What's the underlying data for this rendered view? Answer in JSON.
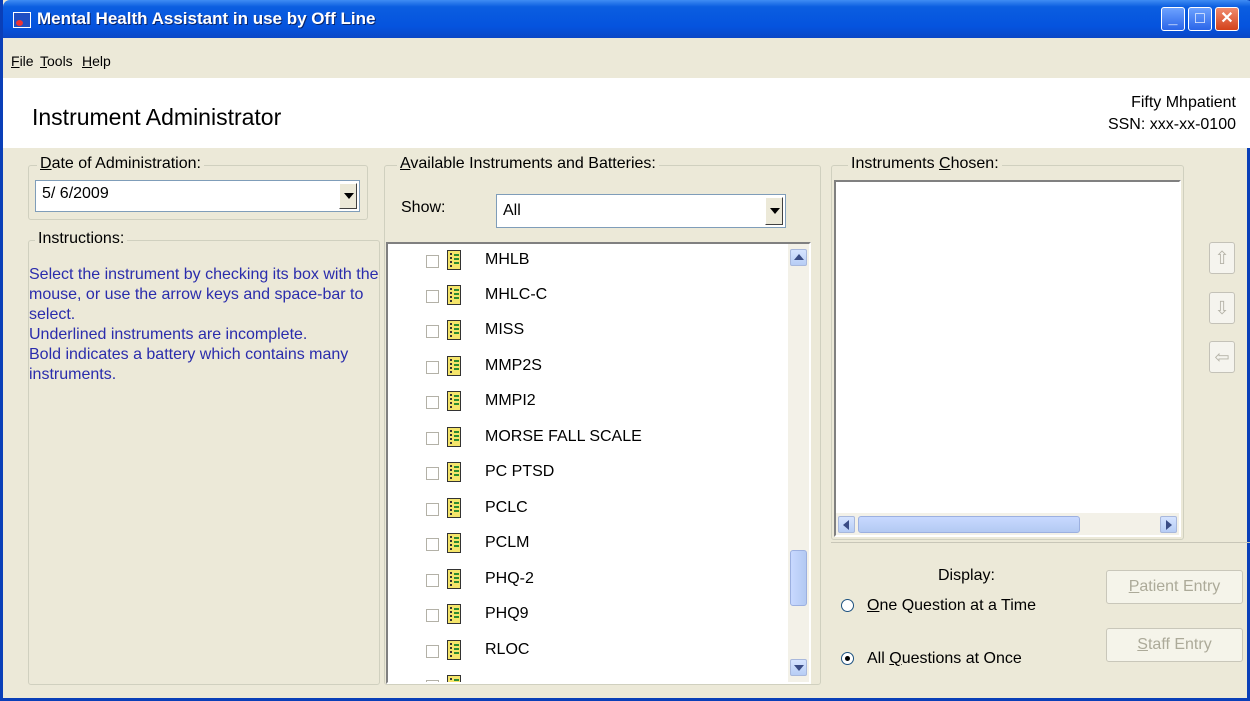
{
  "window": {
    "title": "Mental Health Assistant in use by Off Line",
    "minimize": "_",
    "maximize": "□",
    "close": "✕"
  },
  "menu": [
    {
      "key": "F",
      "rest": "ile"
    },
    {
      "key": "T",
      "rest": "ools"
    },
    {
      "key": "H",
      "rest": "elp"
    }
  ],
  "header": {
    "title": "Instrument Administrator",
    "patient_name": "Fifty Mhpatient",
    "ssn": "SSN: xxx-xx-0100"
  },
  "date_group": {
    "label_key": "D",
    "label_rest": "ate of Administration:",
    "value": "5/ 6/2009"
  },
  "instructions": {
    "label": "Instructions:",
    "lines": [
      " Select the instrument by checking its box with the mouse, or use the arrow keys and space-bar to select.",
      " Underlined instruments are incomplete.",
      " Bold indicates a battery which contains many instruments."
    ]
  },
  "available": {
    "label_key": "A",
    "label_rest": "vailable Instruments and Batteries:",
    "show_label": "Show:",
    "show_value": "All",
    "items": [
      "MHLB",
      "MHLC-C",
      "MISS",
      "MMP2S",
      "MMPI2",
      "MORSE FALL SCALE",
      "PC PTSD",
      "PCLC",
      "PCLM",
      "PHQ-2",
      "PHQ9",
      "RLOC"
    ]
  },
  "chosen": {
    "label_pre": "Instruments ",
    "label_key": "C",
    "label_rest": "hosen:"
  },
  "order_buttons": {
    "up": "⇧",
    "down": "⇩",
    "remove": "⇦"
  },
  "display": {
    "label": "Display:",
    "opt1_key": "O",
    "opt1_rest": "ne Question at a Time",
    "opt2_pre": "All ",
    "opt2_key": "Q",
    "opt2_rest": "uestions at Once",
    "selected": "all"
  },
  "buttons": {
    "patient_key": "P",
    "patient_rest": "atient Entry",
    "staff_key": "S",
    "staff_rest": "taff Entry"
  }
}
